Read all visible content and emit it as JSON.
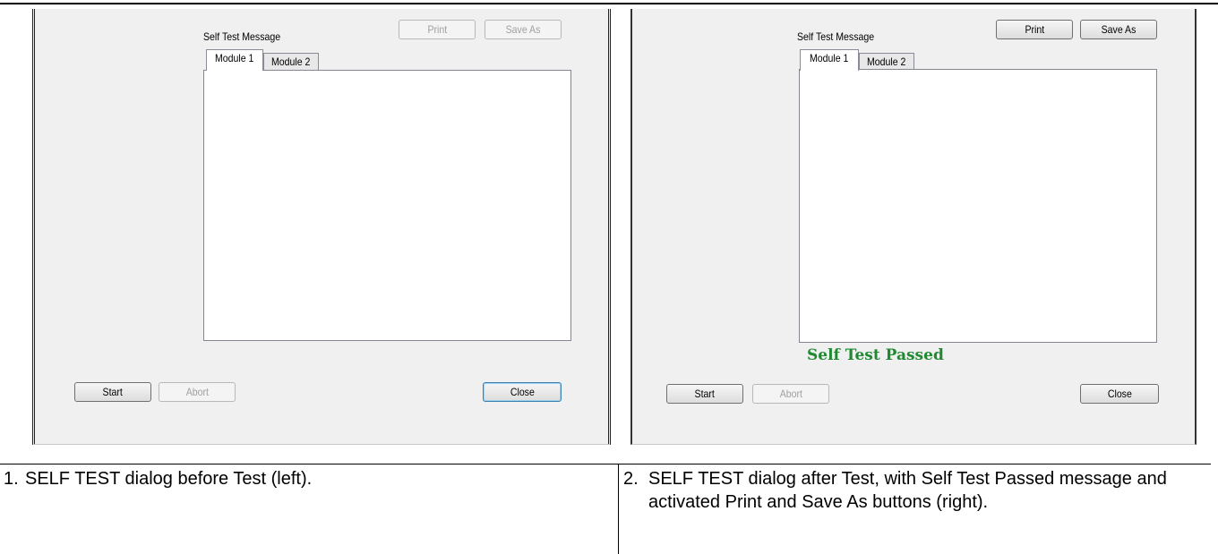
{
  "left_dialog": {
    "title": "Self Test Message",
    "print_label": "Print",
    "save_as_label": "Save As",
    "tab1_label": "Module 1",
    "tab2_label": "Module 2",
    "start_label": "Start",
    "abort_label": "Abort",
    "close_label": "Close",
    "print_enabled": false,
    "save_as_enabled": false
  },
  "right_dialog": {
    "title": "Self Test Message",
    "print_label": "Print",
    "save_as_label": "Save As",
    "tab1_label": "Module 1",
    "tab2_label": "Module 2",
    "status_message": "Self Test Passed",
    "start_label": "Start",
    "abort_label": "Abort",
    "close_label": "Close",
    "print_enabled": true,
    "save_as_enabled": true
  },
  "captions": [
    {
      "number": "1.",
      "text": "SELF TEST dialog before Test (left)."
    },
    {
      "number": "2.",
      "text": "SELF TEST dialog after Test, with Self Test Passed message and activated Print and Save As buttons (right)."
    }
  ],
  "colors": {
    "status_passed": "#1f8a32",
    "dialog_background": "#f0f0f0"
  }
}
